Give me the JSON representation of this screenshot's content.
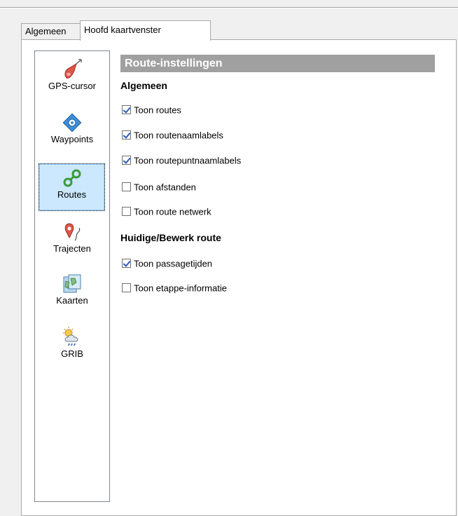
{
  "tabs": [
    {
      "label": "Algemeen",
      "active": false
    },
    {
      "label": "Hoofd kaartvenster",
      "active": true
    }
  ],
  "sidebar": {
    "items": [
      {
        "label": "GPS-cursor",
        "icon": "gps-cursor-icon",
        "selected": false
      },
      {
        "label": "Waypoints",
        "icon": "waypoint-icon",
        "selected": false
      },
      {
        "label": "Routes",
        "icon": "route-icon",
        "selected": true
      },
      {
        "label": "Trajecten",
        "icon": "track-icon",
        "selected": false
      },
      {
        "label": "Kaarten",
        "icon": "map-icon",
        "selected": false
      },
      {
        "label": "GRIB",
        "icon": "weather-icon",
        "selected": false
      }
    ]
  },
  "main": {
    "header": "Route-instellingen",
    "sections": [
      {
        "title": "Algemeen",
        "options": [
          {
            "label": "Toon routes",
            "checked": true
          },
          {
            "label": "Toon routenaamlabels",
            "checked": true
          },
          {
            "label": "Toon routepuntnaamlabels",
            "checked": true
          },
          {
            "label": "Toon afstanden",
            "checked": false
          },
          {
            "label": "Toon route netwerk",
            "checked": false
          }
        ]
      },
      {
        "title": "Huidige/Bewerk route",
        "options": [
          {
            "label": "Toon passagetijden",
            "checked": true
          },
          {
            "label": "Toon etappe-informatie",
            "checked": false
          }
        ]
      }
    ]
  },
  "colors": {
    "header_bg": "#a0a0a0",
    "selection_bg": "#cce8ff",
    "check_color": "#2a5cb8"
  }
}
